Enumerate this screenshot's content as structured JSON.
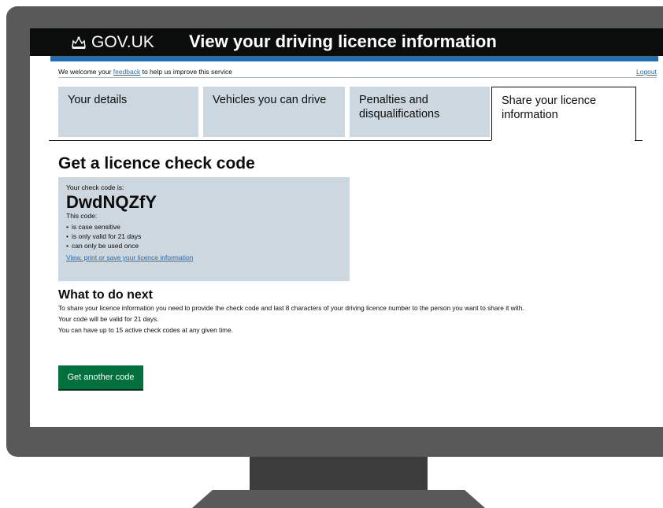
{
  "header": {
    "brand": "GOV.UK",
    "service_title": "View your driving licence information"
  },
  "feedback": {
    "before": "We welcome your ",
    "link": "feedback",
    "after": " to help us improve this service",
    "logout": "Logout"
  },
  "tabs": [
    {
      "label": "Your details"
    },
    {
      "label": "Vehicles you can drive"
    },
    {
      "label": "Penalties and disqualifications"
    },
    {
      "label": "Share your licence information"
    }
  ],
  "heading": "Get a licence check code",
  "panel": {
    "intro": "Your check code is:",
    "code": "DwdNQZfY",
    "this_code": "This code:",
    "bullets": [
      "is case sensitive",
      "is only valid for 21 days",
      "can only be used once"
    ],
    "link": "View, print or save your licence information"
  },
  "next": {
    "heading": "What to do next",
    "lines": [
      "To share your licence information you need to provide the check code and last 8 characters of your driving licence number to the person you want to share it with.",
      "Your code will be valid for 21 days.",
      "You can have up to 15 active check codes at any given time."
    ]
  },
  "button": "Get another code",
  "colors": {
    "header_bg": "#0b0c0c",
    "accent_blue": "#1d70b8",
    "tab_bg": "#cdd7df",
    "button_green": "#00703c",
    "monitor_frame": "#595959"
  }
}
